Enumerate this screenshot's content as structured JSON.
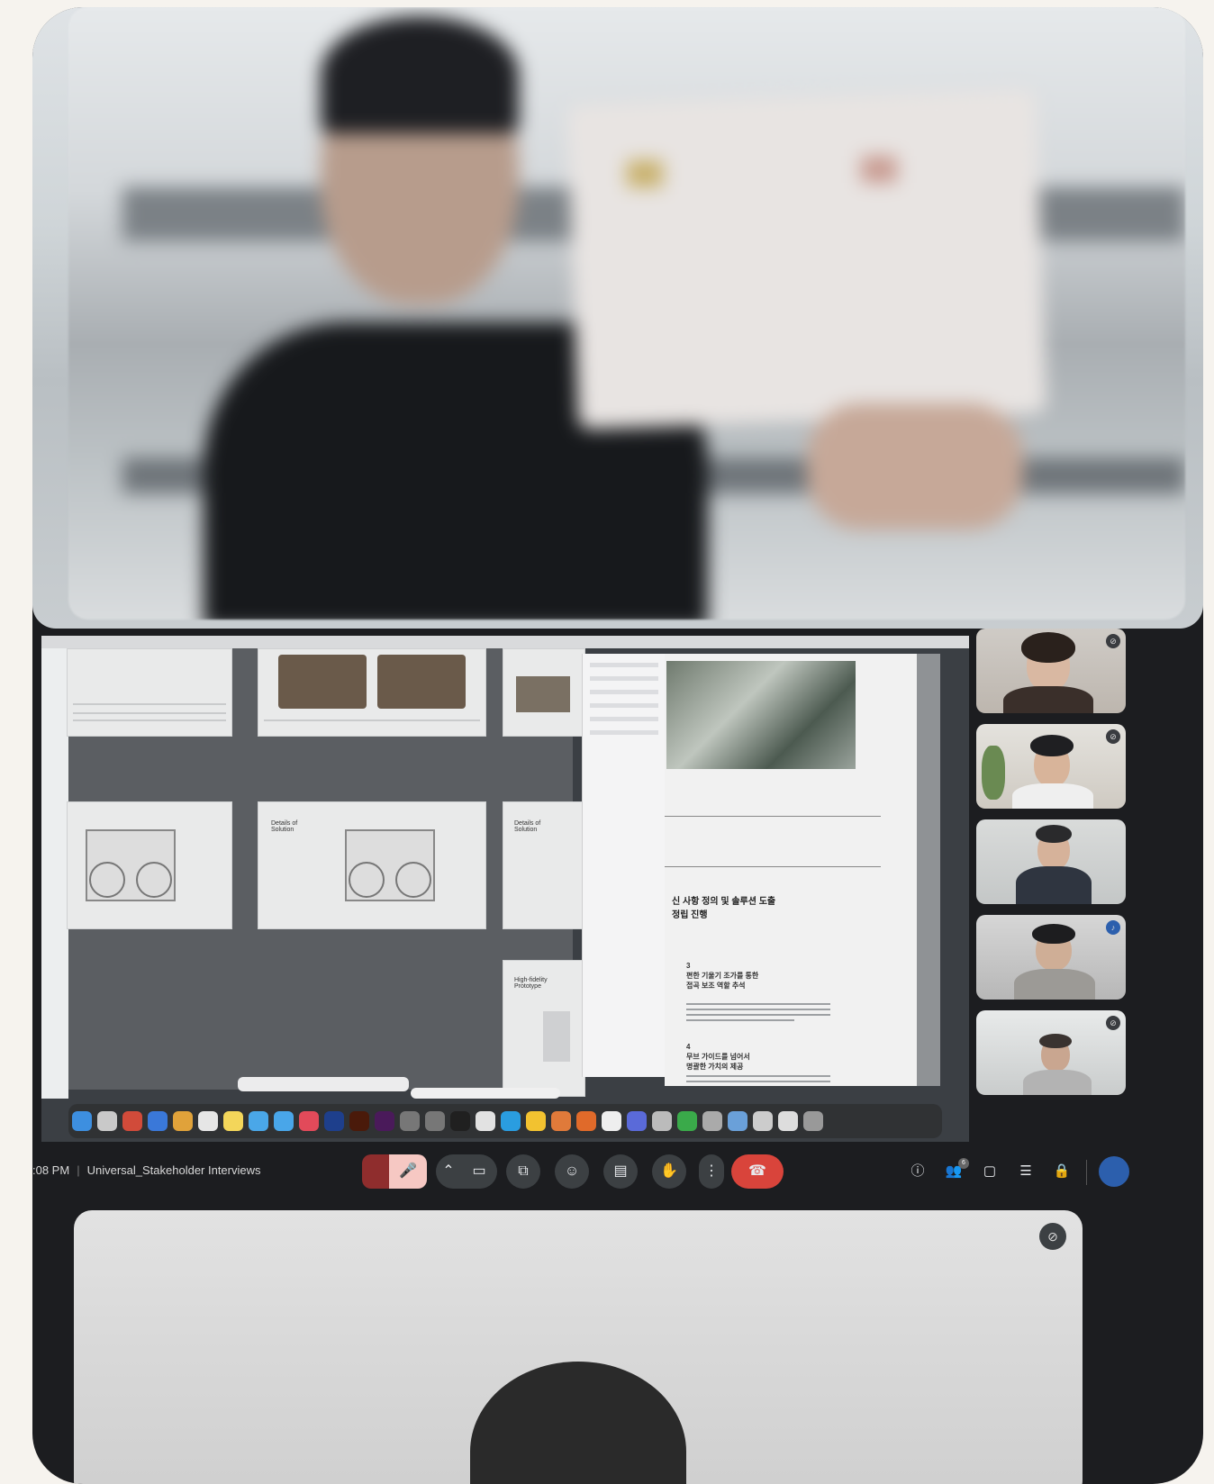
{
  "meeting": {
    "time": ":08 PM",
    "separator": "|",
    "title": "Universal_Stakeholder Interviews"
  },
  "controls": {
    "mic_icon": "mic-off-icon",
    "camera_icon": "camera-icon",
    "present_icon": "present-screen-icon",
    "emoji_icon": "emoji-icon",
    "captions_icon": "captions-icon",
    "raise_hand_icon": "raise-hand-icon",
    "more_icon": "more-options-icon",
    "leave_icon": "end-call-icon",
    "info_icon": "info-icon",
    "people_icon": "people-icon",
    "chat_icon": "chat-icon",
    "activities_icon": "activities-icon",
    "host_icon": "host-controls-icon",
    "people_badge": "6"
  },
  "shared_doc": {
    "heading": "신 사항 정의 및 솔루션 도출\n정립 진행",
    "item1_num": "3",
    "item1_title": "편한 기울기 조가를 통한\n접곡 보조 역할 추석",
    "item2_num": "4",
    "item2_title": "무브 가이드를 넘어서\n명괄한 가치의 제공"
  },
  "slides": {
    "slide_a_title": "Details of\nSolution",
    "slide_b_title": "Details of\nSolution",
    "slide_c_title": "High-fidelity\nPrototype"
  },
  "colors": {
    "leave": "#d9443b",
    "control": "#3c4043",
    "avatar": "#2c5fad"
  }
}
